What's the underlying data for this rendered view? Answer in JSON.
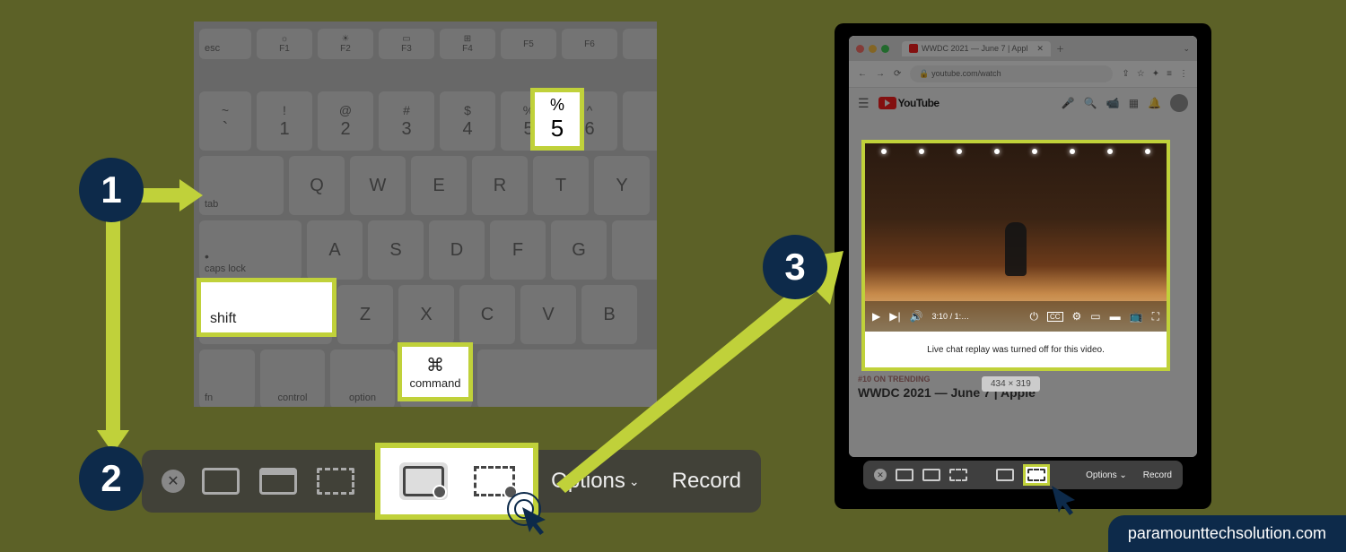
{
  "steps": {
    "s1": "1",
    "s2": "2",
    "s3": "3"
  },
  "keyboard": {
    "row_fn": [
      "esc",
      "F1",
      "F2",
      "F3",
      "F4",
      "F5",
      "F6"
    ],
    "row_num": [
      {
        "t": "~",
        "b": "`"
      },
      {
        "t": "!",
        "b": "1"
      },
      {
        "t": "@",
        "b": "2"
      },
      {
        "t": "#",
        "b": "3"
      },
      {
        "t": "$",
        "b": "4"
      },
      {
        "t": "%",
        "b": "5"
      },
      {
        "t": "^",
        "b": "6"
      }
    ],
    "row_q": [
      "tab",
      "Q",
      "W",
      "E",
      "R",
      "T",
      "Y"
    ],
    "row_a": [
      "caps lock",
      "A",
      "S",
      "D",
      "F",
      "G"
    ],
    "row_z": [
      "shift",
      "Z",
      "X",
      "C",
      "V",
      "B"
    ],
    "row_bottom": [
      "fn",
      "control",
      "option",
      "command"
    ],
    "hl_5_top": "%",
    "hl_5_bot": "5",
    "hl_shift": "shift",
    "hl_cmd_sym": "⌘",
    "hl_cmd": "command"
  },
  "toolbar": {
    "options": "Options",
    "record": "Record"
  },
  "browser": {
    "tab_title": "WWDC 2021 — June 7 | Appl",
    "url": "youtube.com/watch",
    "yt_brand": "YouTube",
    "chat_msg": "Live chat replay was turned off for this video.",
    "dimensions": "434 × 319",
    "trending": "#10 ON TRENDING",
    "video_title": "WWDC 2021 — June 7 | Apple",
    "controls_time": "3:10 / 1:…"
  },
  "mini_toolbar": {
    "options": "Options",
    "record": "Record"
  },
  "footer": "paramounttechsolution.com"
}
